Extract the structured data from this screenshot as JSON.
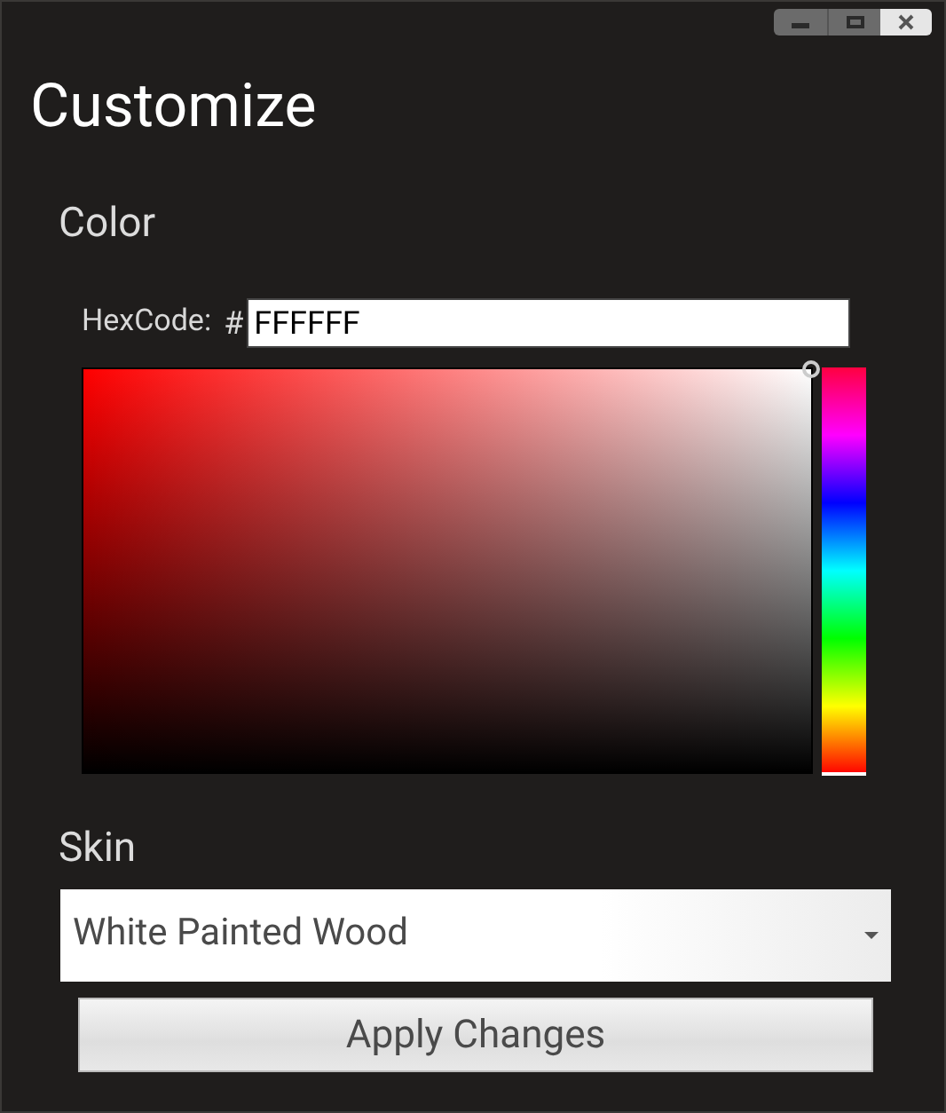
{
  "window": {
    "title": "Customize"
  },
  "color": {
    "heading": "Color",
    "hex_label": "HexCode:",
    "hex_prefix": "#",
    "hex_value": "FFFFFF",
    "hue": {
      "level": 0
    }
  },
  "skin": {
    "heading": "Skin",
    "value": "White Painted Wood"
  },
  "apply_button": "Apply Changes"
}
